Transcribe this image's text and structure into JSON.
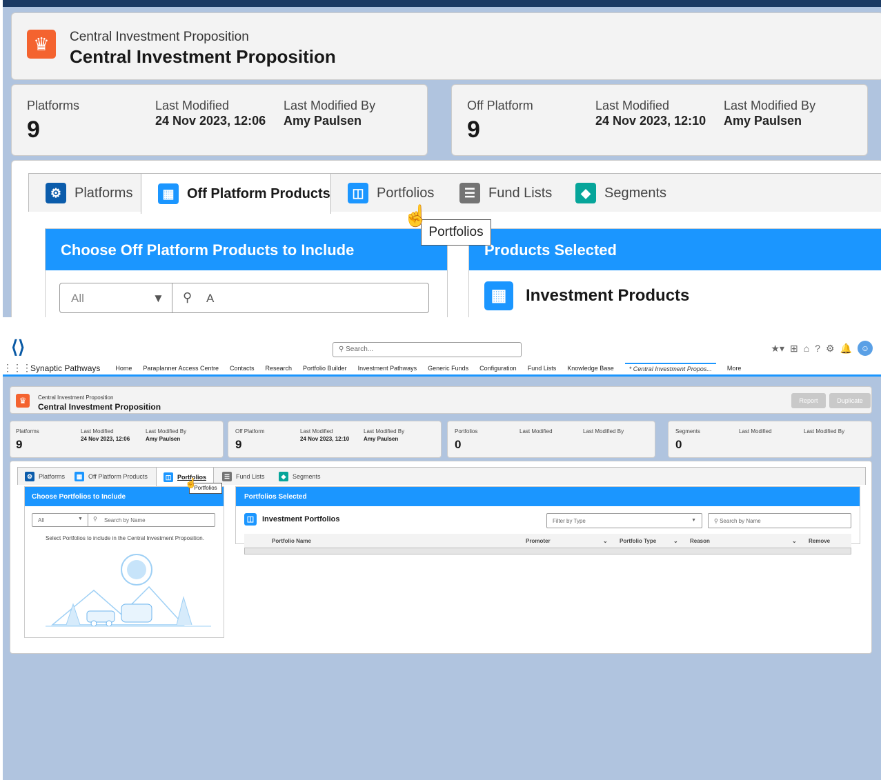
{
  "record": {
    "subtitle": "Central Investment Proposition",
    "title": "Central Investment Proposition"
  },
  "cards": [
    {
      "label": "Platforms",
      "count": "9",
      "mod_label": "Last Modified",
      "mod_value": "24 Nov 2023, 12:06",
      "by_label": "Last Modified By",
      "by_value": "Amy Paulsen"
    },
    {
      "label": "Off Platform",
      "count": "9",
      "mod_label": "Last Modified",
      "mod_value": "24 Nov 2023, 12:10",
      "by_label": "Last Modified By",
      "by_value": "Amy Paulsen"
    },
    {
      "label": "Portfolios",
      "count": "0",
      "mod_label": "Last Modified",
      "mod_value": "",
      "by_label": "Last Modified By",
      "by_value": ""
    },
    {
      "label": "Segments",
      "count": "0",
      "mod_label": "Last Modified",
      "mod_value": "",
      "by_label": "Last Modified By",
      "by_value": ""
    }
  ],
  "tabs": [
    "Platforms",
    "Off Platform Products",
    "Portfolios",
    "Fund Lists",
    "Segments"
  ],
  "tooltip": "Portfolios",
  "zoom": {
    "left_header": "Choose Off Platform Products to Include",
    "right_header": "Products Selected",
    "filter_value": "All",
    "search_value": "A",
    "section_title": "Investment Products"
  },
  "header": {
    "search_placeholder": "Search...",
    "app_name": "Synaptic Pathways"
  },
  "nav": [
    "Home",
    "Paraplanner Access Centre",
    "Contacts",
    "Research",
    "Portfolio Builder",
    "Investment Pathways",
    "Generic Funds",
    "Configuration",
    "Fund Lists",
    "Knowledge Base"
  ],
  "nav_active": "* Central Investment Propos...",
  "nav_more": "More",
  "buttons": {
    "report": "Report",
    "duplicate": "Duplicate"
  },
  "left_panel": {
    "header": "Choose Portfolios to Include",
    "filter": "All",
    "search_placeholder": "Search by Name",
    "message": "Select Portfolios to include in the Central Investment Proposition."
  },
  "right_panel": {
    "header": "Portfolios Selected",
    "section_title": "Investment Portfolios",
    "filter_type": "Filter by Type",
    "search_placeholder": "Search by Name",
    "columns": [
      "Portfolio Name",
      "Promoter",
      "Portfolio Type",
      "Reason",
      "Remove"
    ]
  }
}
